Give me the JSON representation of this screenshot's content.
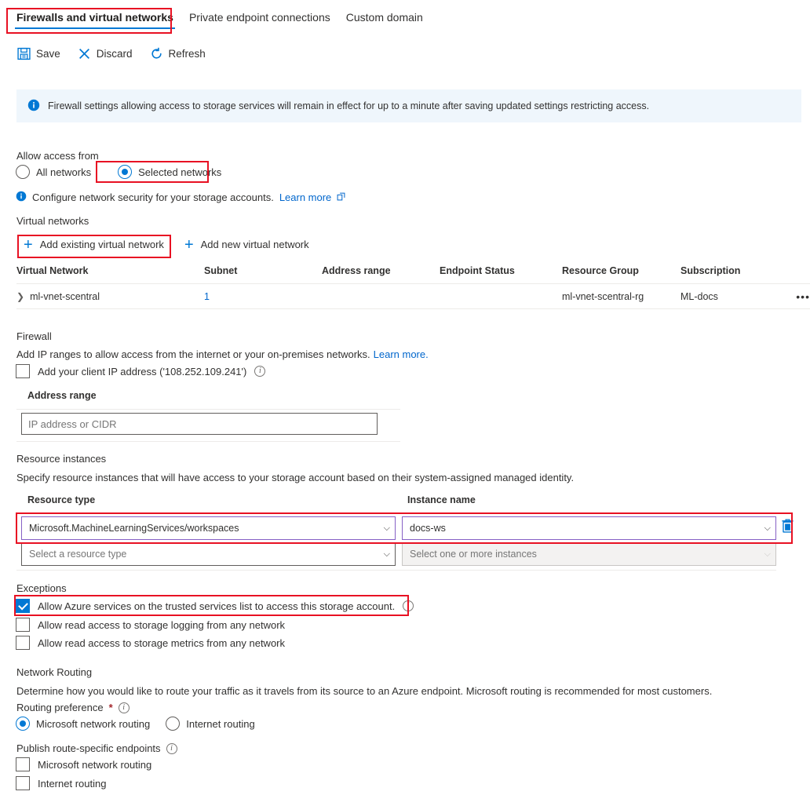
{
  "tabs": [
    {
      "label": "Firewalls and virtual networks",
      "active": true
    },
    {
      "label": "Private endpoint connections",
      "active": false
    },
    {
      "label": "Custom domain",
      "active": false
    }
  ],
  "toolbar": {
    "save_label": "Save",
    "discard_label": "Discard",
    "refresh_label": "Refresh"
  },
  "banner": {
    "text": "Firewall settings allowing access to storage services will remain in effect for up to a minute after saving updated settings restricting access."
  },
  "allow_access": {
    "label": "Allow access from",
    "options": [
      {
        "label": "All networks",
        "selected": false
      },
      {
        "label": "Selected networks",
        "selected": true
      }
    ],
    "hint_text": "Configure network security for your storage accounts.",
    "hint_link": "Learn more"
  },
  "virtual_networks": {
    "label": "Virtual networks",
    "add_existing_label": "Add existing virtual network",
    "add_new_label": "Add new virtual network",
    "columns": [
      "Virtual Network",
      "Subnet",
      "Address range",
      "Endpoint Status",
      "Resource Group",
      "Subscription"
    ],
    "rows": [
      {
        "virtual_network": "ml-vnet-scentral",
        "subnet": "1",
        "address_range": "",
        "endpoint_status": "",
        "resource_group": "ml-vnet-scentral-rg",
        "subscription": "ML-docs",
        "menu": "•••"
      }
    ]
  },
  "firewall": {
    "label": "Firewall",
    "description": "Add IP ranges to allow access from the internet or your on-premises networks.",
    "description_link": "Learn more.",
    "client_ip_label": "Add your client IP address ('108.252.109.241')",
    "client_ip_checked": false,
    "address_range_label": "Address range",
    "address_range_value": "",
    "address_range_placeholder": "IP address or CIDR"
  },
  "resource_instances": {
    "label": "Resource instances",
    "description": "Specify resource instances that will have access to your storage account based on their system-assigned managed identity.",
    "col_resource_type": "Resource type",
    "col_instance_name": "Instance name",
    "rows": [
      {
        "resource_type": "Microsoft.MachineLearningServices/workspaces",
        "instance_name": "docs-ws",
        "disabled": false,
        "delete_icon": "trash-icon"
      },
      {
        "resource_type": "Select a resource type",
        "instance_name": "Select one or more instances",
        "disabled": true,
        "delete_icon": ""
      }
    ]
  },
  "exceptions": {
    "label": "Exceptions",
    "items": [
      {
        "label": "Allow Azure services on the trusted services list to access this storage account.",
        "checked": true,
        "info": true
      },
      {
        "label": "Allow read access to storage logging from any network",
        "checked": false,
        "info": false
      },
      {
        "label": "Allow read access to storage metrics from any network",
        "checked": false,
        "info": false
      }
    ]
  },
  "network_routing": {
    "label": "Network Routing",
    "description": "Determine how you would like to route your traffic as it travels from its source to an Azure endpoint. Microsoft routing is recommended for most customers.",
    "routing_preference_label": "Routing preference",
    "required_mark": "*",
    "routing_options": [
      {
        "label": "Microsoft network routing",
        "selected": true
      },
      {
        "label": "Internet routing",
        "selected": false
      }
    ],
    "publish_label": "Publish route-specific endpoints",
    "publish_options": [
      {
        "label": "Microsoft network routing",
        "checked": false
      },
      {
        "label": "Internet routing",
        "checked": false
      }
    ]
  },
  "colors": {
    "accent": "#0078d4",
    "annotation": "#e81123",
    "banner_bg": "#eff6fc",
    "focus_border": "#8661c5",
    "link": "#0066cc"
  }
}
